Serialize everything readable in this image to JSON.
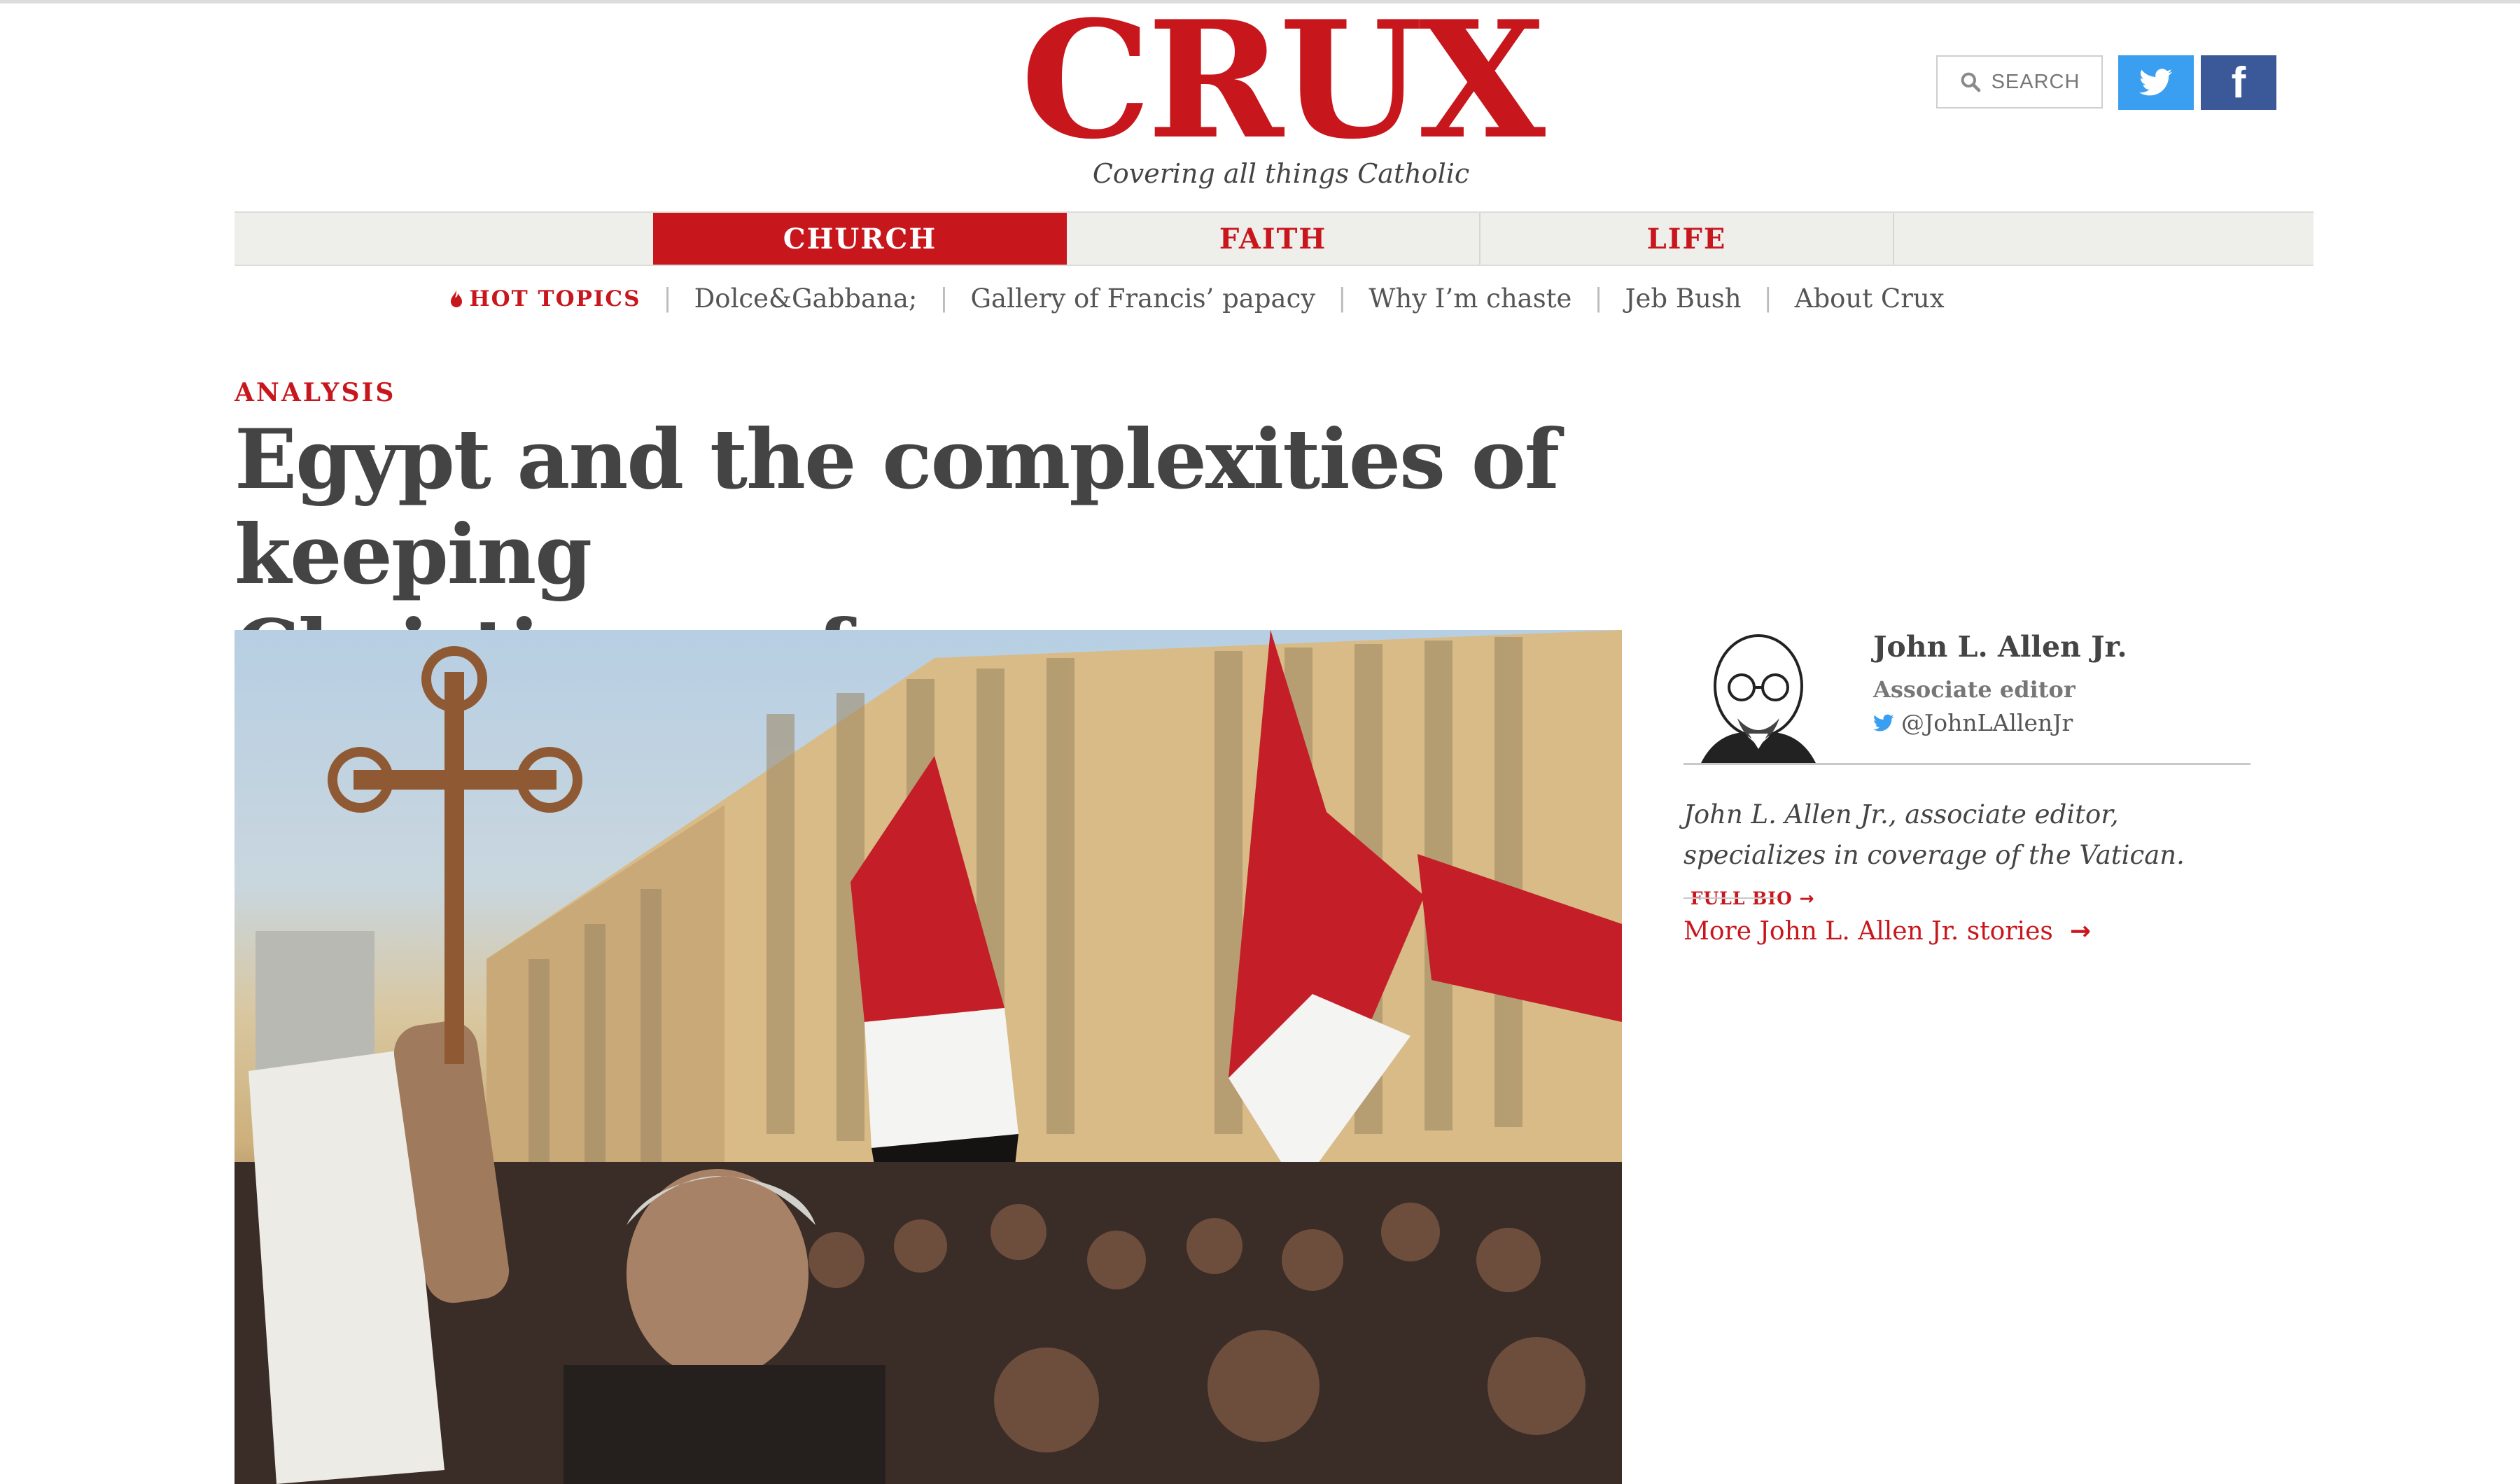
{
  "brand": {
    "logo": "CRUX",
    "tagline": "Covering all things Catholic",
    "color": "#c8161d"
  },
  "header": {
    "search_label": "SEARCH",
    "twitter_icon": "twitter-bird-icon",
    "facebook_label": "f"
  },
  "nav": {
    "tabs": [
      {
        "label": "CHURCH",
        "active": true
      },
      {
        "label": "FAITH",
        "active": false
      },
      {
        "label": "LIFE",
        "active": false
      }
    ]
  },
  "hot_topics": {
    "label": "HOT TOPICS",
    "icon": "flame-icon",
    "items": [
      "Dolce&Gabbana;",
      "Gallery of Francis’ papacy",
      "Why I’m chaste",
      "Jeb Bush",
      "About Crux"
    ]
  },
  "article": {
    "kicker": "ANALYSIS",
    "headline_line1": "Egypt and the complexities of keeping",
    "headline_line2": "Christians safe"
  },
  "author": {
    "name": "John L. Allen Jr.",
    "role": "Associate editor",
    "handle": "@JohnLAllenJr",
    "bio": "John L. Allen Jr., associate editor, specializes in coverage of the Vatican.",
    "full_bio_label": "FULL BIO",
    "more_stories_label": "More John L. Allen Jr. stories"
  }
}
